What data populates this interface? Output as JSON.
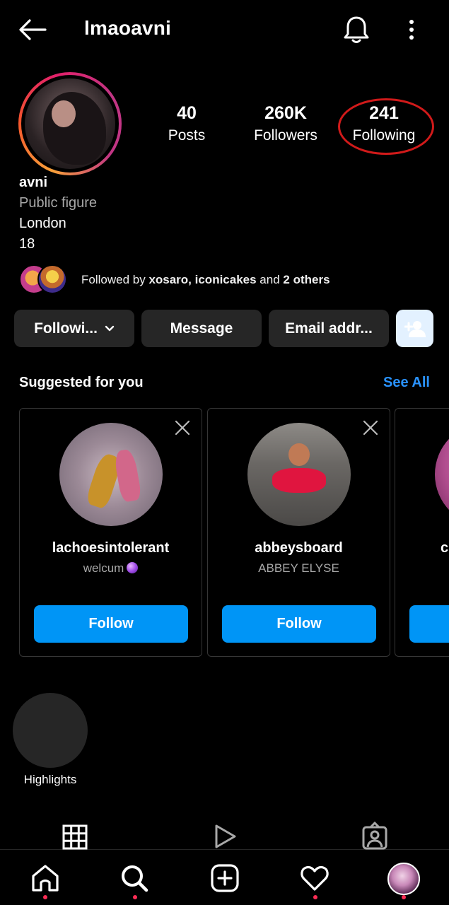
{
  "header": {
    "username": "lmaoavni",
    "icons": {
      "back": "back-arrow-icon",
      "notifications": "bell-icon",
      "menu": "more-vertical-icon"
    }
  },
  "profile": {
    "stats": [
      {
        "value": "40",
        "label": "Posts"
      },
      {
        "value": "260K",
        "label": "Followers"
      },
      {
        "value": "241",
        "label": "Following"
      }
    ],
    "name": "avni",
    "category": "Public figure",
    "bio_lines": [
      "London",
      "18"
    ],
    "mutual": {
      "prefix": "Followed by ",
      "names": "xosaro, iconicakes",
      "joiner": " and ",
      "others": "2 others"
    }
  },
  "actions": {
    "following_label": "Followi...",
    "message_label": "Message",
    "email_label": "Email addr..."
  },
  "suggested": {
    "title": "Suggested for you",
    "see_all": "See All",
    "cards": [
      {
        "username": "lachoesintolerant",
        "subtitle": "welcum",
        "follow": "Follow"
      },
      {
        "username": "abbeysboard",
        "subtitle": "ABBEY ELYSE",
        "follow": "Follow"
      },
      {
        "username": "c",
        "subtitle": "",
        "follow": ""
      }
    ]
  },
  "highlights": {
    "label": "Highlights"
  },
  "colors": {
    "accent_blue": "#0095f6",
    "link_blue": "#2a93ff",
    "annotation_red": "#d11a1a",
    "notification_dot": "#ff2d55"
  }
}
